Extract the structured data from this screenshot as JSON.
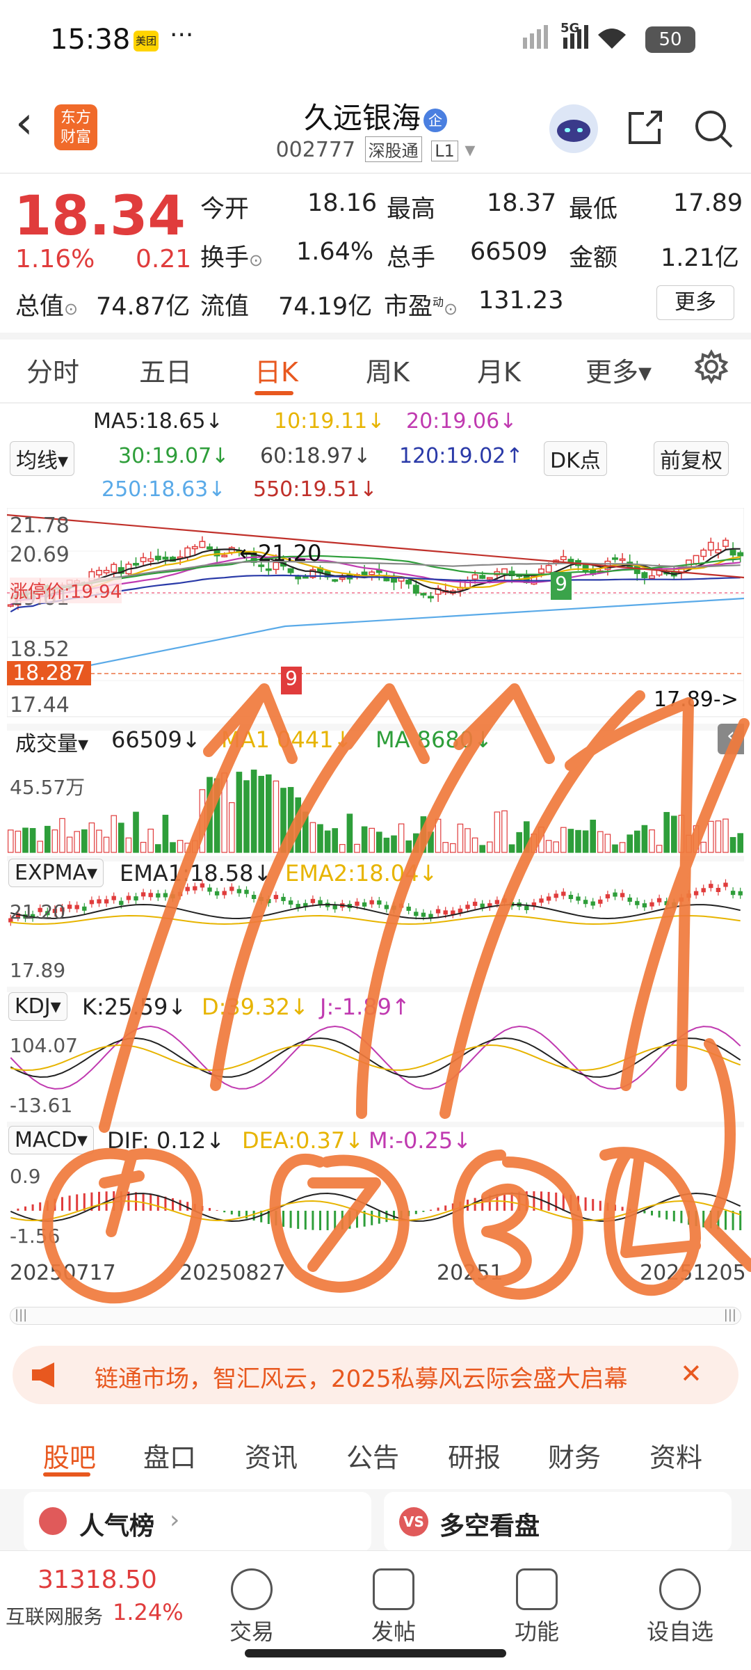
{
  "status_bar": {
    "time": "15:38",
    "app_badge": "美团",
    "dots": "···",
    "network": "5G",
    "battery": "50"
  },
  "header": {
    "back": "‹",
    "logo_text": "东方\n财富",
    "title": "久远银海",
    "title_badge": "企",
    "code": "002777",
    "tag1": "深股通",
    "tag2": "L1",
    "dropdown": "▾"
  },
  "quote": {
    "price": "18.34",
    "pct": "1.16%",
    "change": "0.21",
    "open_label": "今开",
    "open": "18.16",
    "high_label": "最高",
    "high": "18.37",
    "low_label": "最低",
    "low": "17.89",
    "turnover_label": "换手",
    "turnover": "1.64%",
    "volume_label": "总手",
    "volume": "66509",
    "amount_label": "金额",
    "amount": "1.21亿",
    "mktcap_label": "总值",
    "mktcap": "74.87亿",
    "float_label": "流值",
    "float": "74.19亿",
    "pe_label": "市盈",
    "pe_sup": "动",
    "pe": "131.23",
    "more": "更多"
  },
  "tabs": [
    "分时",
    "五日",
    "日K",
    "周K",
    "月K",
    "更多▾"
  ],
  "active_tab": "日K",
  "ma_legend": {
    "ma5": "MA5:18.65↓",
    "ma10": "10:19.11↓",
    "ma20": "20:19.06↓",
    "ma30": "30:19.07↓",
    "ma60": "60:18.97↓",
    "ma120": "120:19.02↑",
    "ma250": "250:18.63↓",
    "ma550": "550:19.51↓",
    "junxian": "均线▾",
    "dk": "DK点",
    "fq": "前复权"
  },
  "kchart": {
    "y_labels": [
      "21.78",
      "20.69",
      "19.61",
      "18.52",
      "17.44"
    ],
    "current_tag": "18.287",
    "limit_label": "涨停价:19.94",
    "high_marker": "21.20",
    "low_marker": "17.89",
    "nine_a": "9",
    "nine_b": "9"
  },
  "volume_panel": {
    "label": "成交量▾",
    "value": "66509↓",
    "ma1": "MA1 0441↓",
    "ma2": "MA 8680↓",
    "y_top": "45.57万"
  },
  "expma_panel": {
    "label": "EXPMA▾",
    "ema1": "EMA1:18.58↓",
    "ema2": "EMA2:18.04↓",
    "y_top": "21.20",
    "y_bottom": "17.89"
  },
  "kdj_panel": {
    "label": "KDJ▾",
    "k": "K:25.59↓",
    "d": "D:39.32↓",
    "j": "J:-1.89↑",
    "y_top": "104.07",
    "y_bottom": "-13.61"
  },
  "macd_panel": {
    "label": "MACD▾",
    "dif": "DIF: 0.12↓",
    "dea": "DEA:0.37↓",
    "m": "M:-0.25↓",
    "y_top": "0.9",
    "y_bottom": "-1.56"
  },
  "x_labels": [
    "20250717",
    "20250827",
    "20251",
    "20251205"
  ],
  "banner": {
    "text": "链通市场，智汇风云，2025私募风云际会盛大启幕",
    "close": "✕"
  },
  "bottom_tabs": [
    "股吧",
    "盘口",
    "资讯",
    "公告",
    "研报",
    "财务",
    "资料"
  ],
  "cards": {
    "left": "人气榜",
    "right": "多空看盘",
    "right_badge": "VS"
  },
  "bottom_bar": {
    "index_value": "31318.50",
    "index_name": "互联网服务",
    "index_pct": "1.24%",
    "items": [
      "交易",
      "发帖",
      "功能",
      "设自选"
    ]
  },
  "colors": {
    "up": "#e03c3c",
    "down": "#2e9e3a",
    "accent": "#e8581f",
    "annotation": "#f07a3c"
  }
}
